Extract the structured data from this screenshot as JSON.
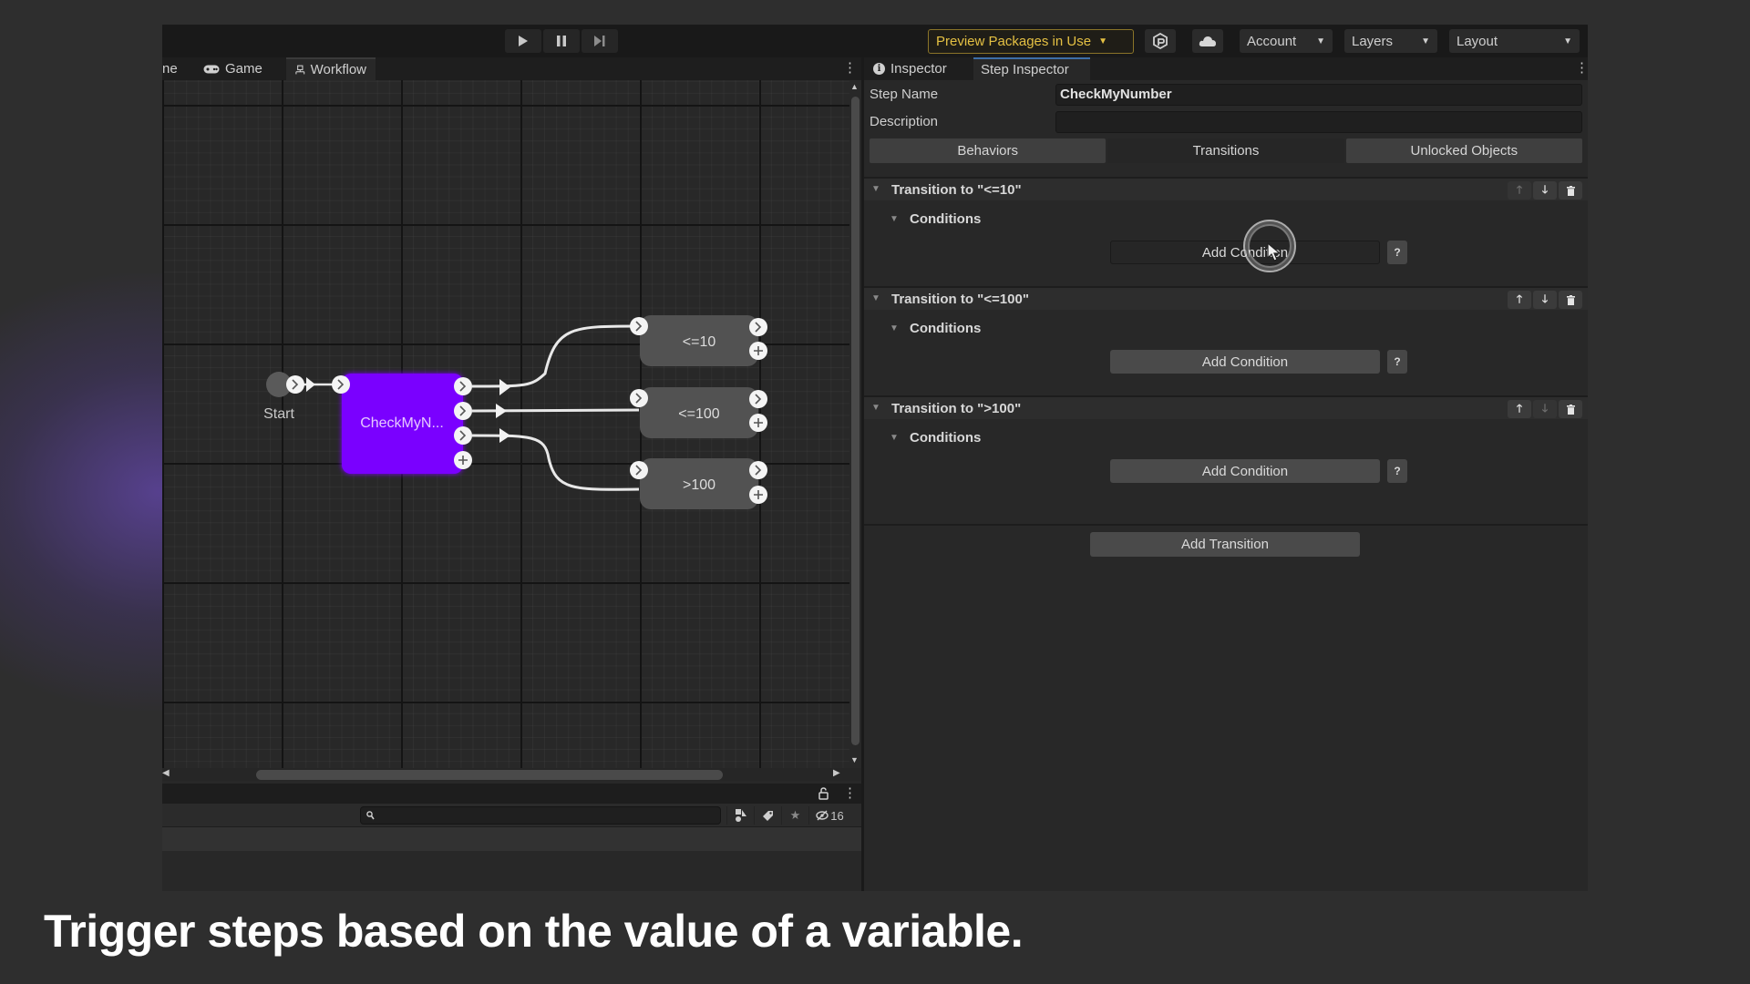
{
  "toolbar": {
    "play_icon": "play-icon",
    "pause_icon": "pause-icon",
    "step_icon": "step-forward-icon",
    "preview_packages_label": "Preview Packages in Use",
    "collab_icon": "collab-icon",
    "cloud_icon": "cloud-icon",
    "account_label": "Account",
    "layers_label": "Layers",
    "layout_label": "Layout"
  },
  "graph_panel": {
    "tabs": [
      {
        "label": "ne",
        "icon": "scene-icon",
        "active": false
      },
      {
        "label": "Game",
        "icon": "gamepad-icon",
        "active": false
      },
      {
        "label": "Workflow",
        "icon": "workflow-icon",
        "active": true
      }
    ],
    "nodes": {
      "start": {
        "label": "Start"
      },
      "main": {
        "label": "CheckMyN...",
        "full_name": "CheckMyNumber",
        "color": "#7a00ff"
      },
      "targets": [
        {
          "label": "<=10"
        },
        {
          "label": "<=100"
        },
        {
          "label": ">100"
        }
      ]
    }
  },
  "bottom_panel": {
    "search_placeholder": "",
    "hidden_count": "16"
  },
  "inspector": {
    "tabs": [
      {
        "label": "Inspector",
        "icon": "info-icon",
        "active": false
      },
      {
        "label": "Step Inspector",
        "active": true
      }
    ],
    "step_name_label": "Step Name",
    "step_name_value": "CheckMyNumber",
    "description_label": "Description",
    "description_value": "",
    "sections": [
      {
        "label": "Behaviors",
        "active": false
      },
      {
        "label": "Transitions",
        "active": true
      },
      {
        "label": "Unlocked Objects",
        "active": false
      }
    ],
    "transitions": [
      {
        "title": "Transition to \"<=10\"",
        "conditions_label": "Conditions",
        "add_condition_label": "Add Condition",
        "help_label": "?",
        "up_enabled": false,
        "down_enabled": true
      },
      {
        "title": "Transition to \"<=100\"",
        "conditions_label": "Conditions",
        "add_condition_label": "Add Condition",
        "help_label": "?",
        "up_enabled": true,
        "down_enabled": true
      },
      {
        "title": "Transition to \">100\"",
        "conditions_label": "Conditions",
        "add_condition_label": "Add Condition",
        "help_label": "?",
        "up_enabled": true,
        "down_enabled": false
      }
    ],
    "add_transition_label": "Add Transition"
  },
  "caption": "Trigger steps based on the value of a variable."
}
